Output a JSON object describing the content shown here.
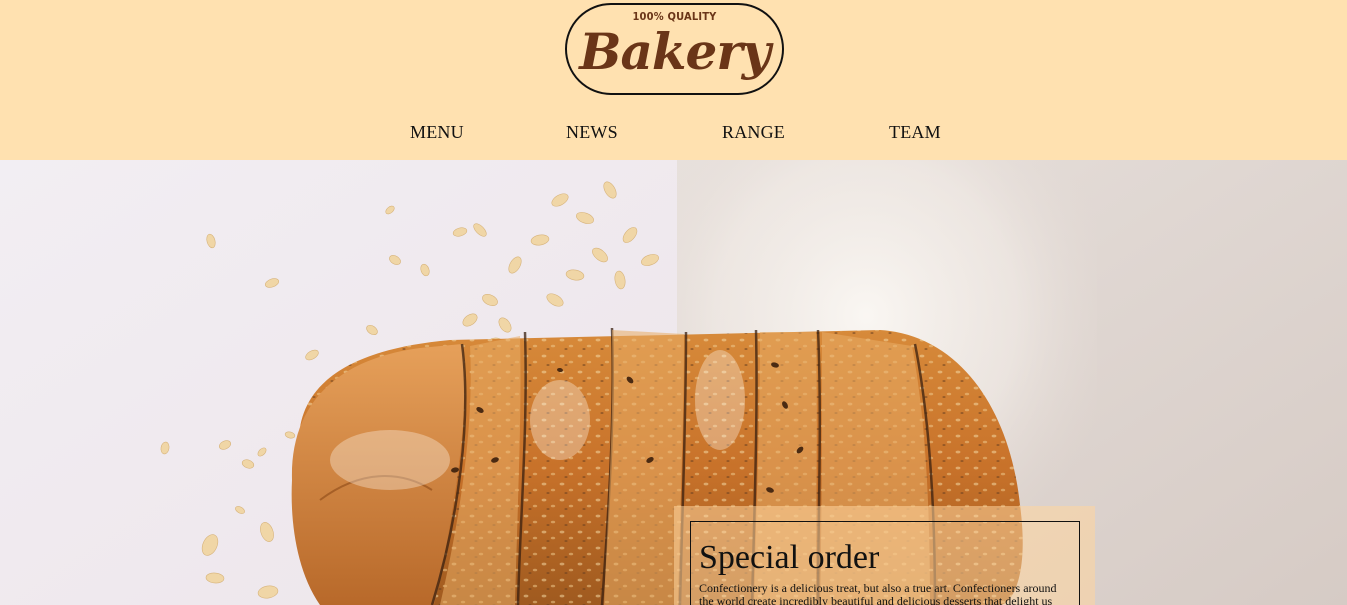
{
  "logo": {
    "tagline": "100% QUALITY",
    "wordmark": "Bakery"
  },
  "nav": {
    "items": [
      {
        "label": "MENU"
      },
      {
        "label": "NEWS"
      },
      {
        "label": "RANGE"
      },
      {
        "label": "TEAM"
      }
    ]
  },
  "hero": {
    "image": "bread-loaf-photo"
  },
  "special_order": {
    "title": "Special order",
    "text": "Confectionery is a delicious treat, but also a true art. Confectioners around the world create incredibly beautiful and delicious desserts that delight us with"
  },
  "colors": {
    "header_bg": "#ffe1b0",
    "logo_brown": "#6a3518",
    "text": "#111111"
  }
}
